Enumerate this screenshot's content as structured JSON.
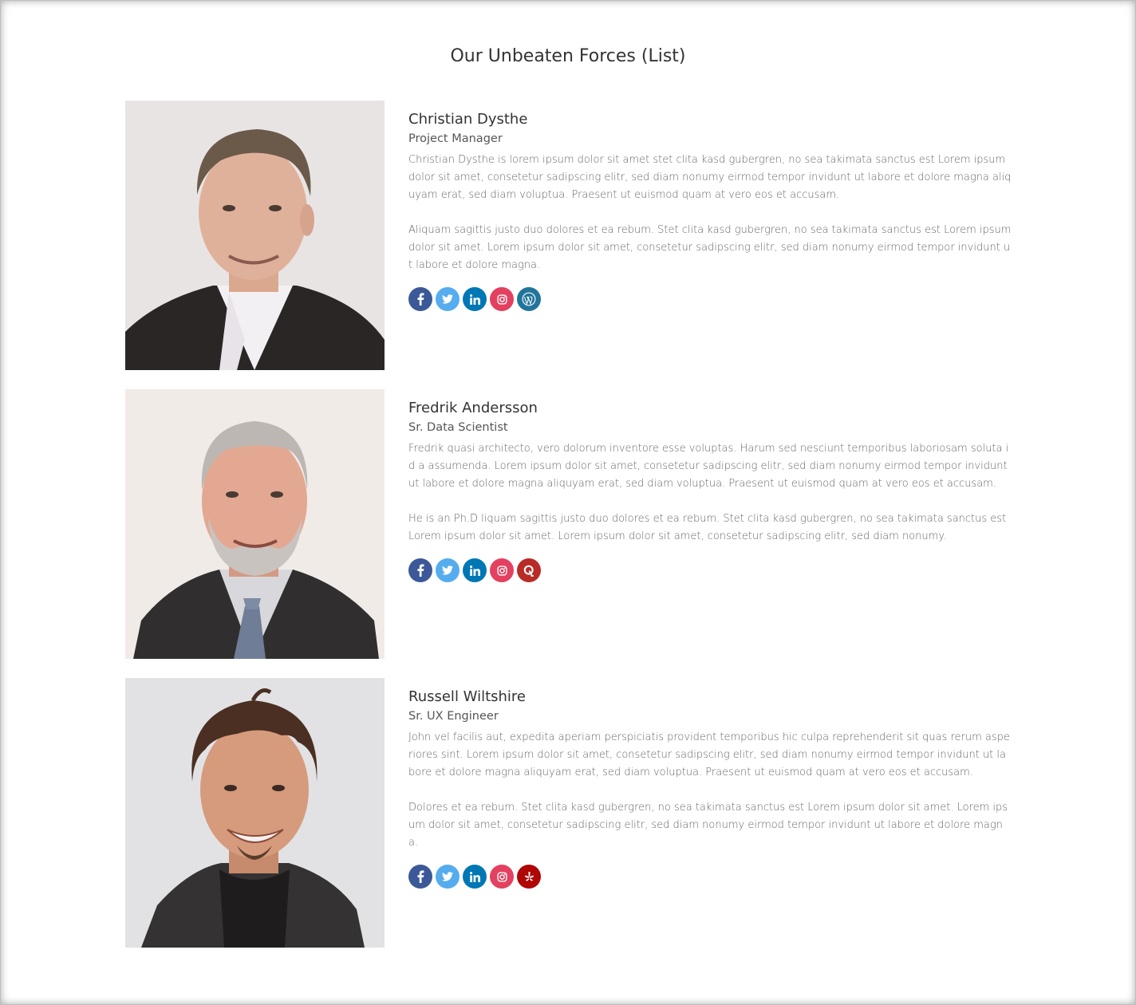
{
  "page": {
    "title": "Our Unbeaten Forces (List)"
  },
  "colors": {
    "facebook": "#3b5998",
    "twitter": "#55acee",
    "linkedin": "#0077b5",
    "instagram": "#e4405f",
    "wordpress": "#21759b",
    "quora": "#b92b27",
    "yelp": "#af0606"
  },
  "members": [
    {
      "name": "Christian Dysthe",
      "role": "Project Manager",
      "bio1": "Christian Dysthe is lorem ipsum dolor sit amet stet clita kasd gubergren, no sea takimata sanctus est Lorem ipsum dolor sit amet, consetetur sadipscing elitr, sed diam nonumy eirmod tempor invidunt ut labore et dolore magna aliquyam erat, sed diam voluptua. Praesent ut euismod quam at vero eos et accusam.",
      "bio2": "Aliquam sagittis justo duo dolores et ea rebum. Stet clita kasd gubergren, no sea takimata sanctus est Lorem ipsum dolor sit amet. Lorem ipsum dolor sit amet, consetetur sadipscing elitr, sed diam nonumy eirmod tempor invidunt ut labore et dolore magna.",
      "socials": [
        "facebook-icon",
        "twitter-icon",
        "linkedin-icon",
        "instagram-icon",
        "wordpress-icon"
      ]
    },
    {
      "name": "Fredrik Andersson",
      "role": "Sr. Data Scientist",
      "bio1": "Fredrik quasi architecto, vero dolorum inventore esse voluptas. Harum sed nesciunt temporibus laboriosam soluta id a assumenda. Lorem ipsum dolor sit amet, consetetur sadipscing elitr, sed diam nonumy eirmod tempor invidunt ut labore et dolore magna aliquyam erat, sed diam voluptua. Praesent ut euismod quam at vero eos et accusam.",
      "bio2": "He is an Ph.D liquam sagittis justo duo dolores et ea rebum. Stet clita kasd gubergren, no sea takimata sanctus est Lorem ipsum dolor sit amet. Lorem ipsum dolor sit amet, consetetur sadipscing elitr, sed diam nonumy.",
      "socials": [
        "facebook-icon",
        "twitter-icon",
        "linkedin-icon",
        "instagram-icon",
        "quora-icon"
      ]
    },
    {
      "name": "Russell Wiltshire",
      "role": "Sr. UX Engineer",
      "bio1": "John vel facilis aut, expedita aperiam perspiciatis provident temporibus hic culpa reprehenderit sit quas rerum asperiores sint. Lorem ipsum dolor sit amet, consetetur sadipscing elitr, sed diam nonumy eirmod tempor invidunt ut labore et dolore magna aliquyam erat, sed diam voluptua. Praesent ut euismod quam at vero eos et accusam.",
      "bio2": "Dolores et ea rebum. Stet clita kasd gubergren, no sea takimata sanctus est Lorem ipsum dolor sit amet. Lorem ipsum dolor sit amet, consetetur sadipscing elitr, sed diam nonumy eirmod tempor invidunt ut labore et dolore magna.",
      "socials": [
        "facebook-icon",
        "twitter-icon",
        "linkedin-icon",
        "instagram-icon",
        "yelp-icon"
      ]
    }
  ]
}
